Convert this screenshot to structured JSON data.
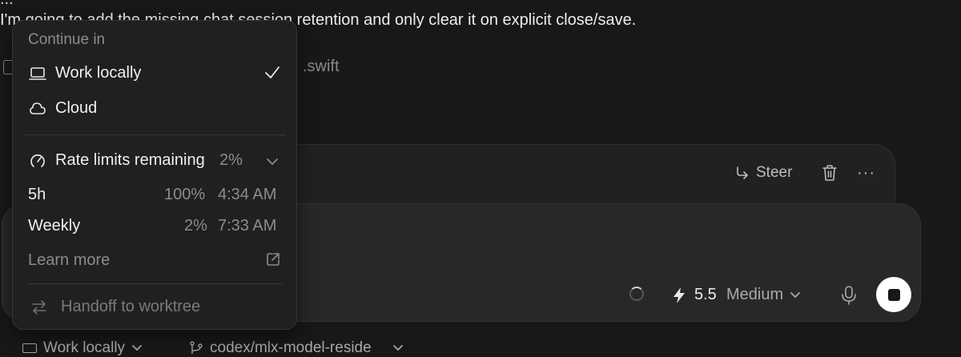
{
  "chat": {
    "partial_line": "I'm going to add the missing chat session retention and only clear it on explicit close/save.",
    "file_suffix": ".swift"
  },
  "queued": {
    "steer_label": "Steer",
    "more_label": "···"
  },
  "composer": {
    "model_version": "5.5",
    "effort_label": "Medium"
  },
  "bottom_bar": {
    "mode_label": "Work locally",
    "branch_label": "codex/mlx-model-reside"
  },
  "menu": {
    "header": "Continue in",
    "options": [
      {
        "label": "Work locally",
        "icon": "laptop-icon",
        "selected": true
      },
      {
        "label": "Cloud",
        "icon": "cloud-icon",
        "selected": false
      }
    ],
    "rate_limits": {
      "label": "Rate limits remaining",
      "value": "2%",
      "rows": [
        {
          "name": "5h",
          "percent": "100%",
          "reset": "4:34 AM"
        },
        {
          "name": "Weekly",
          "percent": "2%",
          "reset": "7:33 AM"
        }
      ]
    },
    "learn_more": "Learn more",
    "handoff": "Handoff to worktree"
  },
  "colors": {
    "background": "#181818",
    "menu_background": "#202020",
    "composer_background": "#282828",
    "stop_button": "#ffffff"
  }
}
